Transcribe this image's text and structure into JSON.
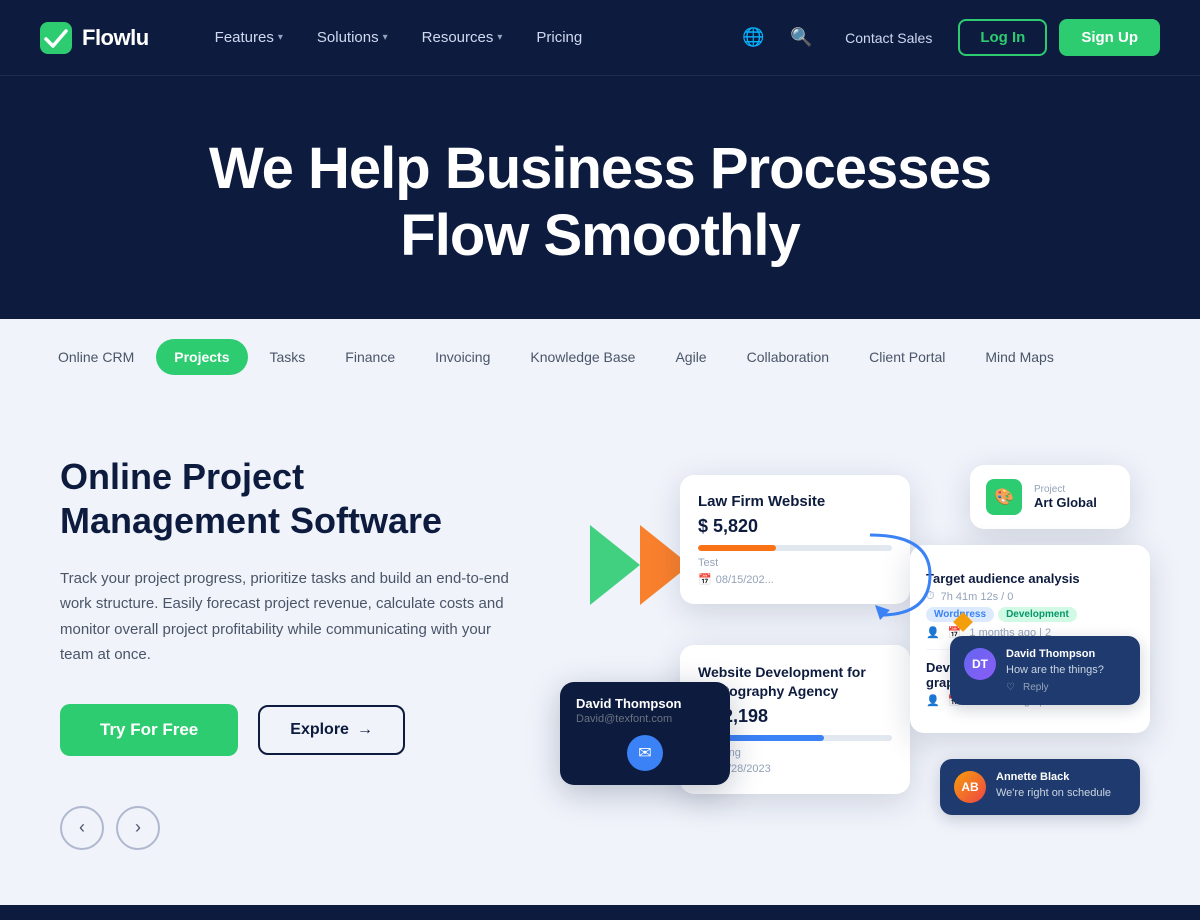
{
  "brand": {
    "logo_icon": "✓",
    "name": "Flowlu"
  },
  "navbar": {
    "features_label": "Features",
    "solutions_label": "Solutions",
    "resources_label": "Resources",
    "pricing_label": "Pricing",
    "contact_sales_label": "Contact Sales",
    "login_label": "Log In",
    "signup_label": "Sign Up"
  },
  "hero": {
    "headline_line1": "We Help Business Processes",
    "headline_line2": "Flow Smoothly"
  },
  "tabs": [
    {
      "label": "Online CRM",
      "active": false
    },
    {
      "label": "Projects",
      "active": true
    },
    {
      "label": "Tasks",
      "active": false
    },
    {
      "label": "Finance",
      "active": false
    },
    {
      "label": "Invoicing",
      "active": false
    },
    {
      "label": "Knowledge Base",
      "active": false
    },
    {
      "label": "Agile",
      "active": false
    },
    {
      "label": "Collaboration",
      "active": false
    },
    {
      "label": "Client Portal",
      "active": false
    },
    {
      "label": "Mind Maps",
      "active": false
    }
  ],
  "content": {
    "heading_line1": "Online Project",
    "heading_line2": "Management Software",
    "description": "Track your project progress, prioritize tasks and build an end-to-end work structure. Easily forecast project revenue, calculate costs and monitor overall project profitability while communicating with your team at once.",
    "try_btn": "Try For Free",
    "explore_btn": "Explore",
    "explore_arrow": "→"
  },
  "mockup": {
    "card1": {
      "name": "Law Firm Website",
      "amount": "$ 5,820",
      "progress": 40,
      "label": "Test",
      "date": "08/15/202..."
    },
    "card2": {
      "name": "Website Development for Photography Agency",
      "amount": "$ 12,198",
      "progress": 65,
      "label": "Planning",
      "date": "07/28/2023"
    },
    "card_art": {
      "label": "Project",
      "name": "Art Global"
    },
    "tasks": [
      {
        "title": "Target audience analysis",
        "meta": "7h 41m 12s / 0",
        "tags": [
          "Wordpress",
          "Development"
        ],
        "footer": "1 months ago | 2"
      },
      {
        "title": "Development of the basic graphic concept",
        "meta": "",
        "tags": [],
        "footer": "1 months ago | 5"
      }
    ],
    "chat_david": {
      "name": "David Thompson",
      "message": "How are the things?",
      "like": "♡",
      "reply": "Reply"
    },
    "chat_annette": {
      "name": "Annette Black",
      "message": "We're right on schedule"
    },
    "contact": {
      "name": "David Thompson",
      "email": "David@texfont.com"
    }
  }
}
